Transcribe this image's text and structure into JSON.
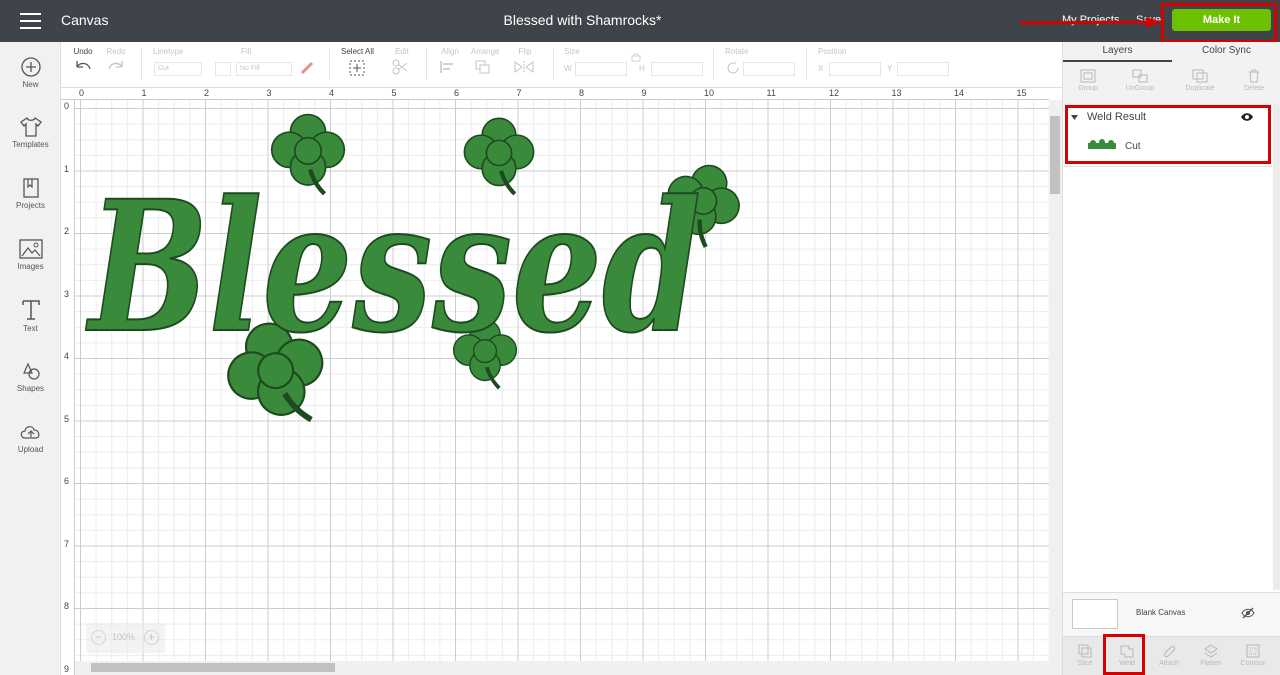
{
  "topbar": {
    "app_title": "Canvas",
    "doc_title": "Blessed with Shamrocks*",
    "my_projects": "My Projects",
    "save": "Save",
    "make_it": "Make It"
  },
  "sidebar": {
    "items": [
      {
        "label": "New",
        "icon": "plus-circle-icon"
      },
      {
        "label": "Templates",
        "icon": "shirt-icon"
      },
      {
        "label": "Projects",
        "icon": "projects-icon"
      },
      {
        "label": "Images",
        "icon": "image-icon"
      },
      {
        "label": "Text",
        "icon": "text-icon"
      },
      {
        "label": "Shapes",
        "icon": "shapes-icon"
      },
      {
        "label": "Upload",
        "icon": "upload-icon"
      }
    ]
  },
  "toolbar": {
    "undo": "Undo",
    "redo": "Redo",
    "linetype": "Linetype",
    "linetype_value": "Cut",
    "fill": "Fill",
    "fill_value": "No Fill",
    "select_all": "Select All",
    "edit": "Edit",
    "align": "Align",
    "arrange": "Arrange",
    "flip": "Flip",
    "size": "Size",
    "size_w": "W",
    "size_h": "H",
    "rotate": "Rotate",
    "position": "Position",
    "pos_x": "X",
    "pos_y": "Y"
  },
  "ruler": {
    "h": [
      "0",
      "1",
      "2",
      "3",
      "4",
      "5",
      "6",
      "7",
      "8",
      "9",
      "10",
      "11",
      "12",
      "13",
      "14",
      "15"
    ],
    "v": [
      "0",
      "1",
      "2",
      "3",
      "4",
      "5",
      "6",
      "7",
      "8",
      "9"
    ]
  },
  "canvas": {
    "design_text": "Blessed",
    "design_color": "#3a8a3c",
    "zoom": "100%"
  },
  "panel": {
    "tabs": [
      "Layers",
      "Color Sync"
    ],
    "tools": [
      "Group",
      "UnGroup",
      "Duplicate",
      "Delete"
    ],
    "group_name": "Weld Result",
    "layer_name": "Cut",
    "blank_canvas": "Blank Canvas",
    "bottom_tools": [
      "Slice",
      "Weld",
      "Attach",
      "Flatten",
      "Contour"
    ]
  },
  "colors": {
    "topbar": "#3e4449",
    "make_it": "#6cc000",
    "highlight": "#d50000"
  }
}
